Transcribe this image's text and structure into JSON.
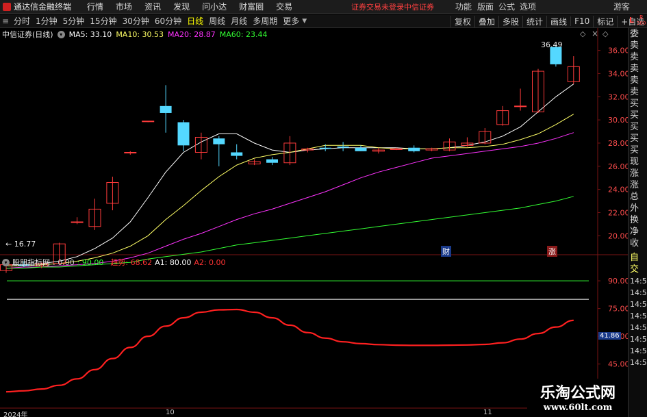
{
  "menubar": {
    "logo_text": "通达信金融终端",
    "items": [
      "行情",
      "市场",
      "资讯",
      "发现",
      "问小达",
      "财富圈",
      "交易"
    ],
    "notice": "证券交易未登录",
    "broker": "中信证券",
    "right_items": [
      "功能",
      "版面",
      "公式",
      "选项"
    ],
    "user": "游客"
  },
  "toolbar": {
    "periods": [
      "分时",
      "1分钟",
      "5分钟",
      "15分钟",
      "30分钟",
      "60分钟",
      "日线",
      "周线",
      "月线",
      "多周期",
      "更多"
    ],
    "active_index": 6,
    "right_buttons": [
      "复权",
      "叠加",
      "多股",
      "统计",
      "画线",
      "F10",
      "标记",
      "+自选",
      "返回"
    ]
  },
  "main_chart": {
    "title": "中信证券(日线)",
    "legend": [
      {
        "label": "MA5: 33.10",
        "color": "#ffffff"
      },
      {
        "label": "MA10: 30.53",
        "color": "#ffff66"
      },
      {
        "label": "MA20: 28.87",
        "color": "#ff33ff"
      },
      {
        "label": "MA60: 23.44",
        "color": "#33ff33"
      }
    ],
    "max_label": "36.49",
    "min_label": "16.77",
    "markers": [
      "财",
      "涨"
    ],
    "right_corner": {
      "top": "L",
      "r": "R",
      "sub": "300"
    }
  },
  "sub_chart": {
    "title": "股朋指标网",
    "legend": [
      {
        "label": ": 0.00",
        "color": "#c8c8c8"
      },
      {
        "label": ": 90.00",
        "color": "#33ff33"
      },
      {
        "label": "趋势: 68.62",
        "color": "#ff3333"
      },
      {
        "label": "A1: 80.00",
        "color": "#ffffff"
      },
      {
        "label": "A2: 0.00",
        "color": "#ff3333"
      }
    ],
    "current_value": "41.86"
  },
  "right_panel": {
    "items": [
      "委比",
      "卖五",
      "卖四",
      "卖三",
      "卖二",
      "卖一",
      "买一",
      "买二",
      "买三",
      "买四",
      "买五",
      "现价",
      "涨跌",
      "涨幅",
      "总量",
      "外盘",
      "换手",
      "净资",
      "收益",
      "",
      "自动",
      "交易",
      "14:56",
      "14:56",
      "14:56",
      "14:56",
      "14:56",
      "14:56",
      "14:56",
      "14:56"
    ]
  },
  "x_axis_labels": [
    "2024年",
    "10",
    "11"
  ],
  "watermark": {
    "title": "乐淘公式网",
    "url": "www.60lt.com"
  },
  "chart_data": [
    {
      "type": "candlestick",
      "y_ticks": [
        20,
        22,
        24,
        26,
        28,
        30,
        32,
        34,
        36
      ],
      "ylim": [
        18.6,
        37.1
      ],
      "candles": [
        {
          "o": 17.0,
          "h": 17.6,
          "l": 16.8,
          "c": 17.5
        },
        {
          "o": 17.5,
          "h": 17.8,
          "l": 17.3,
          "c": 17.4
        },
        {
          "o": 17.4,
          "h": 17.7,
          "l": 17.2,
          "c": 17.6
        },
        {
          "o": 17.6,
          "h": 19.4,
          "l": 17.5,
          "c": 19.3
        },
        {
          "o": 21.2,
          "h": 21.6,
          "l": 21.0,
          "c": 21.2
        },
        {
          "o": 20.8,
          "h": 23.2,
          "l": 20.5,
          "c": 22.3
        },
        {
          "o": 22.8,
          "h": 25.1,
          "l": 22.2,
          "c": 24.6
        },
        {
          "o": 27.2,
          "h": 27.3,
          "l": 27.0,
          "c": 27.2
        },
        {
          "o": 29.9,
          "h": 29.9,
          "l": 29.8,
          "c": 29.9
        },
        {
          "o": 31.2,
          "h": 33.0,
          "l": 28.9,
          "c": 30.6
        },
        {
          "o": 29.8,
          "h": 30.0,
          "l": 27.3,
          "c": 27.8
        },
        {
          "o": 27.2,
          "h": 28.9,
          "l": 26.6,
          "c": 28.5
        },
        {
          "o": 28.4,
          "h": 28.6,
          "l": 26.0,
          "c": 27.9
        },
        {
          "o": 27.2,
          "h": 27.9,
          "l": 26.6,
          "c": 26.9
        },
        {
          "o": 26.2,
          "h": 26.6,
          "l": 26.1,
          "c": 26.4
        },
        {
          "o": 26.6,
          "h": 26.8,
          "l": 26.1,
          "c": 26.3
        },
        {
          "o": 26.3,
          "h": 28.6,
          "l": 26.1,
          "c": 28.0
        },
        {
          "o": 27.4,
          "h": 27.6,
          "l": 27.2,
          "c": 27.5
        },
        {
          "o": 27.6,
          "h": 27.9,
          "l": 27.3,
          "c": 27.5
        },
        {
          "o": 27.7,
          "h": 28.1,
          "l": 27.3,
          "c": 27.6
        },
        {
          "o": 27.6,
          "h": 27.8,
          "l": 27.3,
          "c": 27.3
        },
        {
          "o": 27.3,
          "h": 27.6,
          "l": 27.1,
          "c": 27.4
        },
        {
          "o": 27.5,
          "h": 27.6,
          "l": 27.4,
          "c": 27.5
        },
        {
          "o": 27.6,
          "h": 27.8,
          "l": 27.2,
          "c": 27.3
        },
        {
          "o": 27.4,
          "h": 27.6,
          "l": 27.3,
          "c": 27.5
        },
        {
          "o": 27.4,
          "h": 28.4,
          "l": 27.3,
          "c": 28.1
        },
        {
          "o": 27.8,
          "h": 28.5,
          "l": 27.7,
          "c": 28.0
        },
        {
          "o": 28.0,
          "h": 29.3,
          "l": 27.9,
          "c": 29.0
        },
        {
          "o": 29.6,
          "h": 31.2,
          "l": 29.5,
          "c": 30.8
        },
        {
          "o": 31.2,
          "h": 32.7,
          "l": 30.8,
          "c": 31.2
        },
        {
          "o": 30.7,
          "h": 34.4,
          "l": 30.6,
          "c": 34.2
        },
        {
          "o": 36.3,
          "h": 36.5,
          "l": 34.6,
          "c": 34.8
        },
        {
          "o": 33.3,
          "h": 35.5,
          "l": 33.1,
          "c": 34.6
        }
      ],
      "series": [
        {
          "name": "MA5",
          "color": "#ffffff",
          "values": [
            17.5,
            17.5,
            17.6,
            17.8,
            18.2,
            18.9,
            19.8,
            21.2,
            23.3,
            25.5,
            27.2,
            28.1,
            28.8,
            28.8,
            28.0,
            27.4,
            27.2,
            27.4,
            27.5,
            27.6,
            27.6,
            27.6,
            27.6,
            27.5,
            27.5,
            27.6,
            27.8,
            28.1,
            28.6,
            29.4,
            30.7,
            32.0,
            33.1
          ]
        },
        {
          "name": "MA10",
          "color": "#ffff66",
          "values": [
            17.4,
            17.4,
            17.5,
            17.6,
            17.8,
            18.1,
            18.5,
            19.1,
            20.0,
            21.4,
            22.6,
            23.9,
            25.1,
            26.1,
            26.7,
            27.0,
            27.2,
            27.5,
            27.8,
            27.8,
            27.8,
            27.6,
            27.5,
            27.5,
            27.5,
            27.6,
            27.6,
            27.7,
            27.9,
            28.3,
            28.8,
            29.6,
            30.5
          ]
        },
        {
          "name": "MA20",
          "color": "#ff33ff",
          "values": [
            17.2,
            17.3,
            17.3,
            17.4,
            17.5,
            17.6,
            17.8,
            18.1,
            18.5,
            19.1,
            19.7,
            20.2,
            20.8,
            21.4,
            21.9,
            22.3,
            22.8,
            23.3,
            23.8,
            24.4,
            25.0,
            25.5,
            25.9,
            26.3,
            26.7,
            26.9,
            27.1,
            27.3,
            27.5,
            27.7,
            28.0,
            28.4,
            28.9
          ]
        },
        {
          "name": "MA60",
          "color": "#33ff33",
          "values": [
            17.2,
            17.2,
            17.3,
            17.3,
            17.4,
            17.5,
            17.6,
            17.7,
            18.0,
            18.2,
            18.4,
            18.6,
            18.9,
            19.2,
            19.4,
            19.6,
            19.8,
            20.0,
            20.2,
            20.4,
            20.6,
            20.8,
            21.0,
            21.2,
            21.4,
            21.6,
            21.8,
            22.0,
            22.2,
            22.4,
            22.7,
            23.0,
            23.4
          ]
        }
      ]
    },
    {
      "type": "line",
      "y_ticks": [
        30,
        45,
        60,
        75,
        90
      ],
      "ylim": [
        23.4,
        99.3
      ],
      "series": [
        {
          "name": "趋势",
          "color": "#ff2020",
          "values": [
            30,
            30.5,
            31.5,
            33.5,
            37,
            42,
            48,
            54,
            60,
            65.5,
            70,
            73,
            74.3,
            74.5,
            73,
            70,
            66,
            62,
            59,
            57,
            56,
            55.5,
            55.2,
            55.1,
            55.1,
            55.2,
            55.3,
            55.6,
            56.5,
            58.5,
            61.5,
            65,
            68.62
          ]
        },
        {
          "name": "",
          "color": "#33ff33",
          "values": [
            90
          ]
        },
        {
          "name": "",
          "color": "#ffffff",
          "values": [
            80
          ]
        }
      ]
    }
  ]
}
